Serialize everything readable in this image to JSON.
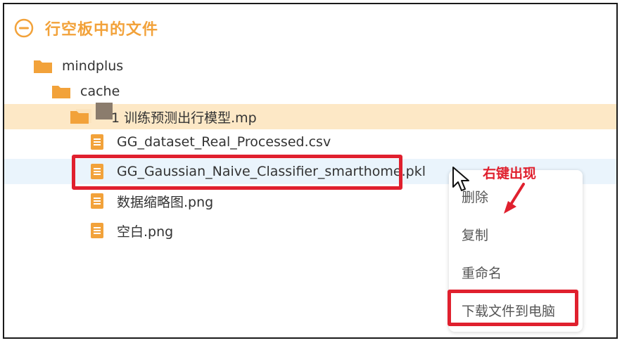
{
  "panel": {
    "title": "行空板中的文件",
    "accent_color": "#f2a23a",
    "header_icon": "circle-minus-icon"
  },
  "tree": [
    {
      "label": "mindplus",
      "icon": "folder-icon",
      "level": 1
    },
    {
      "label": "cache",
      "icon": "folder-icon",
      "level": 2
    },
    {
      "label": "1 训练预测出行模型.mp",
      "icon": "folder-icon",
      "level": 3,
      "highlighted": true
    },
    {
      "label": "GG_dataset_Real_Processed.csv",
      "icon": "file-icon",
      "level": 4
    },
    {
      "label": "GG_Gaussian_Naive_Classifier_smarthome.pkl",
      "icon": "file-icon",
      "level": 4,
      "selected": true
    },
    {
      "label": "数据缩略图.png",
      "icon": "file-icon",
      "level": 4
    },
    {
      "label": "空白.png",
      "icon": "file-icon",
      "level": 4
    }
  ],
  "context_menu": {
    "items": [
      "删除",
      "复制",
      "重命名",
      "下载文件到电脑"
    ]
  },
  "annotation": {
    "text": "右键出现",
    "color": "#e0202e"
  }
}
